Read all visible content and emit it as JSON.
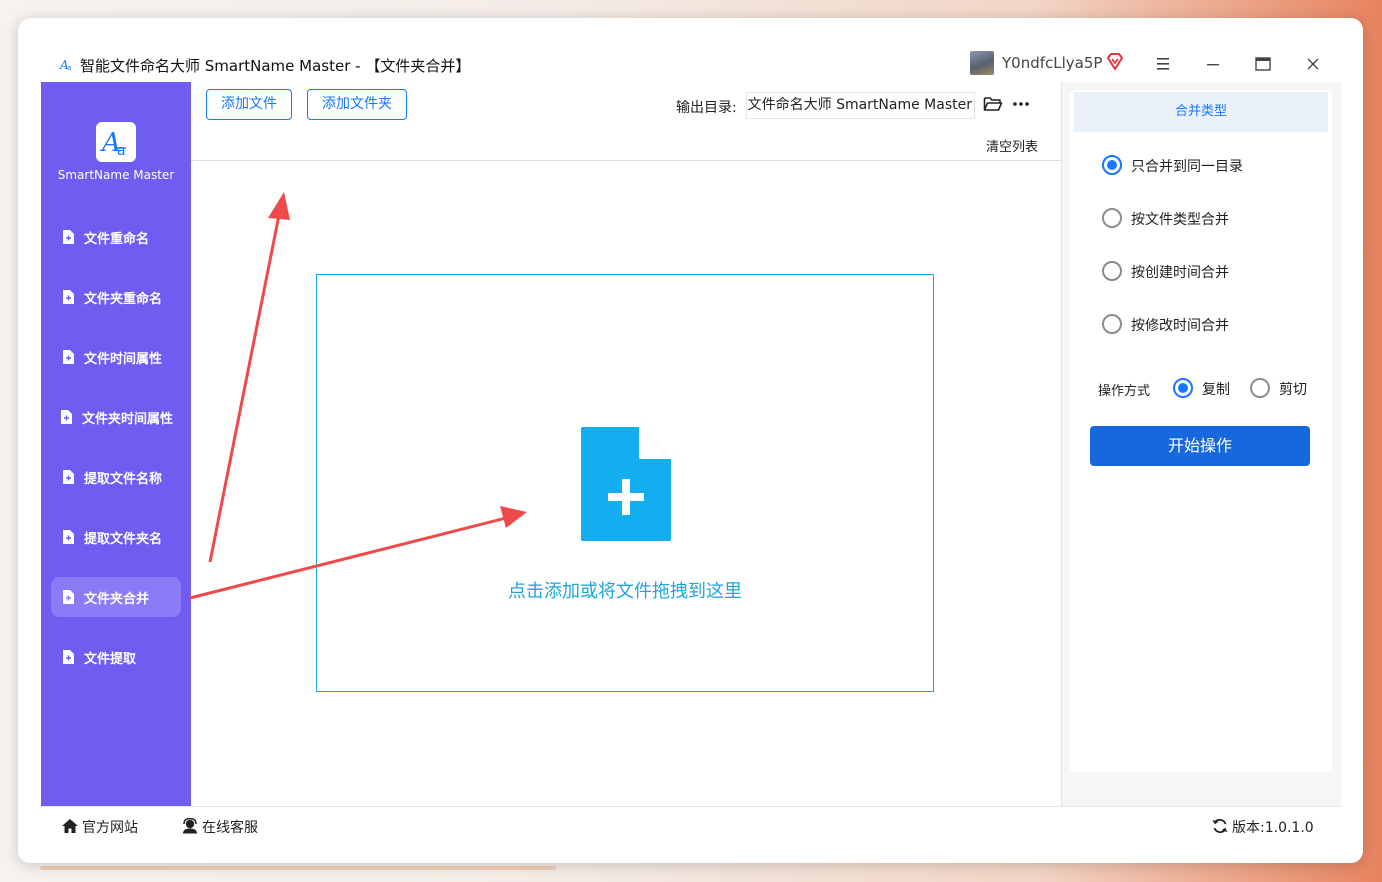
{
  "window": {
    "title": "智能文件命名大师 SmartName Master - 【文件夹合并】",
    "username": "Y0ndfcLlya5P"
  },
  "sidebar": {
    "logo_text": "SmartName Master",
    "items": [
      {
        "label": "文件重命名"
      },
      {
        "label": "文件夹重命名"
      },
      {
        "label": "文件时间属性"
      },
      {
        "label": "文件夹时间属性"
      },
      {
        "label": "提取文件名称"
      },
      {
        "label": "提取文件夹名"
      },
      {
        "label": "文件夹合并",
        "active": true
      },
      {
        "label": "文件提取"
      }
    ]
  },
  "toolbar": {
    "add_file": "添加文件",
    "add_folder": "添加文件夹",
    "output_label": "输出目录:",
    "output_value": "智能文件命名大师 SmartName Master",
    "clear_list": "清空列表"
  },
  "dropzone": {
    "text": "点击添加或将文件拖拽到这里"
  },
  "panel": {
    "merge_type_title": "合并类型",
    "options": [
      {
        "label": "只合并到同一目录",
        "checked": true
      },
      {
        "label": "按文件类型合并",
        "checked": false
      },
      {
        "label": "按创建时间合并",
        "checked": false
      },
      {
        "label": "按修改时间合并",
        "checked": false
      }
    ],
    "operation_label": "操作方式",
    "op_copy": "复制",
    "op_cut": "剪切",
    "op_selected": "复制",
    "start_button": "开始操作"
  },
  "footer": {
    "website": "官方网站",
    "support": "在线客服",
    "version": "版本:1.0.1.0"
  },
  "colors": {
    "sidebar": "#6f5cf0",
    "sidebar_active": "#8b7bf6",
    "accent": "#1677ff",
    "drop_accent": "#1ea6dc",
    "annotation_arrow": "#ef4a4a"
  }
}
